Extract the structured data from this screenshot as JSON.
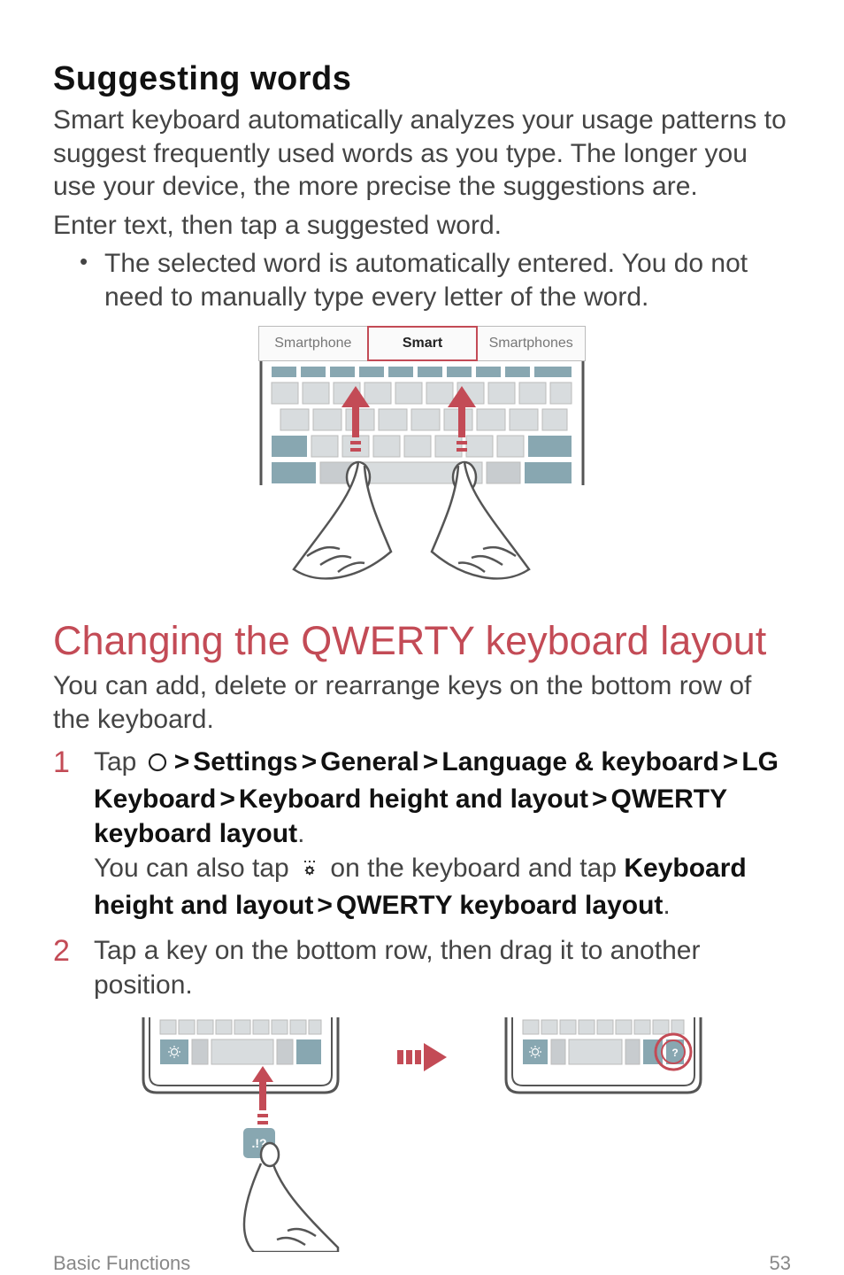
{
  "section1": {
    "title": "Suggesting words",
    "p1": "Smart keyboard automatically analyzes your usage patterns to suggest frequently used words as you type. The longer you use your device, the more precise the suggestions are.",
    "p2": "Enter text, then tap a suggested word.",
    "bullet1": "The selected word is automatically entered. You do not need to manually type every letter of the word.",
    "suggestions": {
      "left": "Smartphone",
      "center": "Smart",
      "right": "Smartphones"
    }
  },
  "section2": {
    "title": "Changing the QWERTY keyboard layout",
    "intro": "You can add, delete or rearrange keys on the bottom row of the keyboard.",
    "step1": {
      "lead": "Tap ",
      "path1": "Settings",
      "path2": "General",
      "path3": "Language & keyboard",
      "path4": "LG Keyboard",
      "path5": "Keyboard height and layout",
      "path6": "QWERTY keyboard layout",
      "alt_lead": "You can also tap ",
      "alt_mid": " on the keyboard and tap ",
      "alt_b1": "Keyboard height and layout",
      "alt_b2": "QWERTY keyboard layout",
      "period": "."
    },
    "step2": "Tap a key on the bottom row, then drag it to another position."
  },
  "footer": {
    "section": "Basic Functions",
    "page": "53"
  }
}
